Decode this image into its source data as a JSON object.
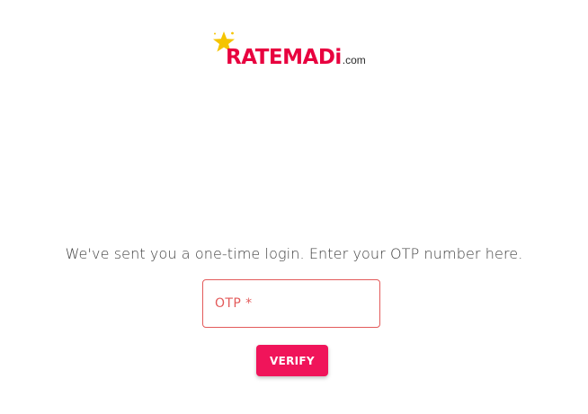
{
  "brand": {
    "name_main": "RATEMADi",
    "name_suffix": ".com",
    "primary_color": "#e8003f",
    "star_color": "#f5c400",
    "icon": "star-icon"
  },
  "message": "We've sent you a one-time login. Enter your OTP number here.",
  "otp_field": {
    "label": "OTP *",
    "value": "",
    "error_color": "#e35a5a"
  },
  "verify_button": {
    "label": "VERIFY",
    "color": "#f0145a"
  }
}
